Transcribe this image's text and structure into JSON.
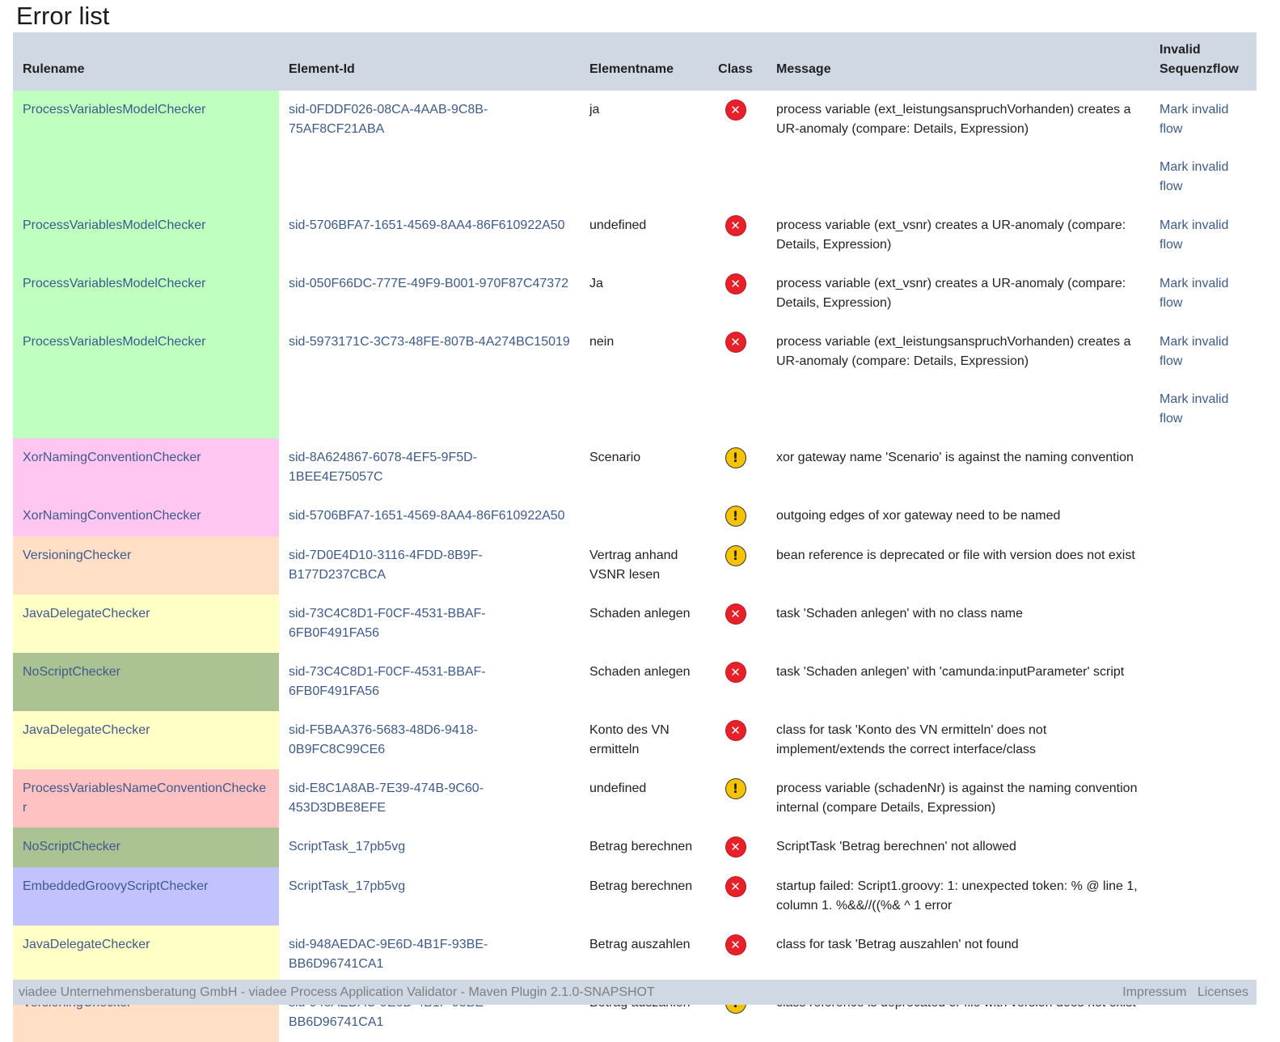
{
  "page": {
    "title": "Error list"
  },
  "table": {
    "headers": {
      "rulename": "Rulename",
      "element_id": "Element-Id",
      "elementname": "Elementname",
      "class": "Class",
      "message": "Message",
      "invalid_flow_line1": "Invalid",
      "invalid_flow_line2": "Sequenzflow"
    },
    "rows": [
      {
        "rule": "ProcessVariablesModelChecker",
        "color": "#bfffbf",
        "element_id": "sid-0FDDF026-08CA-4AAB-9C8B-75AF8CF21ABA",
        "elementname": "ja",
        "class": "error",
        "message": "process variable (ext_leistungsanspruchVorhanden) creates a UR-anomaly (compare: Details, Expression)",
        "flows": [
          "Mark invalid flow",
          "Mark invalid flow"
        ]
      },
      {
        "rule": "ProcessVariablesModelChecker",
        "color": "#bfffbf",
        "element_id": "sid-5706BFA7-1651-4569-8AA4-86F610922A50",
        "elementname": "undefined",
        "class": "error",
        "message": "process variable (ext_vsnr) creates a UR-anomaly (compare: Details, Expression)",
        "flows": [
          "Mark invalid flow"
        ]
      },
      {
        "rule": "ProcessVariablesModelChecker",
        "color": "#bfffbf",
        "element_id": "sid-050F66DC-777E-49F9-B001-970F87C47372",
        "elementname": "Ja",
        "class": "error",
        "message": "process variable (ext_vsnr) creates a UR-anomaly (compare: Details, Expression)",
        "flows": [
          "Mark invalid flow"
        ]
      },
      {
        "rule": "ProcessVariablesModelChecker",
        "color": "#bfffbf",
        "element_id": "sid-5973171C-3C73-48FE-807B-4A274BC15019",
        "elementname": "nein",
        "class": "error",
        "message": "process variable (ext_leistungsanspruchVorhanden) creates a UR-anomaly (compare: Details, Expression)",
        "flows": [
          "Mark invalid flow",
          "Mark invalid flow"
        ]
      },
      {
        "rule": "XorNamingConventionChecker",
        "color": "#ffc6f2",
        "element_id": "sid-8A624867-6078-4EF5-9F5D-1BEE4E75057C",
        "elementname": "Scenario",
        "class": "warning",
        "message": "xor gateway name 'Scenario' is against the naming convention",
        "flows": []
      },
      {
        "rule": "XorNamingConventionChecker",
        "color": "#ffc6f2",
        "element_id": "sid-5706BFA7-1651-4569-8AA4-86F610922A50",
        "elementname": "",
        "class": "warning",
        "message": "outgoing edges of xor gateway need to be named",
        "flows": []
      },
      {
        "rule": "VersioningChecker",
        "color": "#ffdfc6",
        "element_id": "sid-7D0E4D10-3116-4FDD-8B9F-B177D237CBCA",
        "elementname": "Vertrag anhand VSNR lesen",
        "class": "warning",
        "message": "bean reference is deprecated or file with version does not exist",
        "flows": []
      },
      {
        "rule": "JavaDelegateChecker",
        "color": "#ffffc6",
        "element_id": "sid-73C4C8D1-F0CF-4531-BBAF-6FB0F491FA56",
        "elementname": "Schaden anlegen",
        "class": "error",
        "message": "task 'Schaden anlegen' with no class name",
        "flows": []
      },
      {
        "rule": "NoScriptChecker",
        "color": "#abc393",
        "element_id": "sid-73C4C8D1-F0CF-4531-BBAF-6FB0F491FA56",
        "elementname": "Schaden anlegen",
        "class": "error",
        "message": "task 'Schaden anlegen' with 'camunda:inputParameter' script",
        "flows": []
      },
      {
        "rule": "JavaDelegateChecker",
        "color": "#ffffc6",
        "element_id": "sid-F5BAA376-5683-48D6-9418-0B9FC8C99CE6",
        "elementname": "Konto des VN ermitteln",
        "class": "error",
        "message": "class for task 'Konto des VN ermitteln' does not implement/extends the correct interface/class",
        "flows": []
      },
      {
        "rule": "ProcessVariablesNameConventionChecker",
        "color": "#ffc2c2",
        "element_id": "sid-E8C1A8AB-7E39-474B-9C60-453D3DBE8EFE",
        "elementname": "undefined",
        "class": "warning",
        "message": "process variable (schadenNr) is against the naming convention internal (compare Details, Expression)",
        "flows": []
      },
      {
        "rule": "NoScriptChecker",
        "color": "#abc393",
        "element_id": "ScriptTask_17pb5vg",
        "elementname": "Betrag berechnen",
        "class": "error",
        "message": "ScriptTask 'Betrag berechnen' not allowed",
        "flows": []
      },
      {
        "rule": "EmbeddedGroovyScriptChecker",
        "color": "#c2c2ff",
        "element_id": "ScriptTask_17pb5vg",
        "elementname": "Betrag berechnen",
        "class": "error",
        "message": "startup failed: Script1.groovy: 1: unexpected token: % @ line 1, column 1. %&&//((%& ^ 1 error",
        "flows": []
      },
      {
        "rule": "JavaDelegateChecker",
        "color": "#ffffc6",
        "element_id": "sid-948AEDAC-9E6D-4B1F-93BE-BB6D96741CA1",
        "elementname": "Betrag auszahlen",
        "class": "error",
        "message": "class for task 'Betrag auszahlen' not found",
        "flows": []
      },
      {
        "rule": "VersioningChecker",
        "color": "#ffdfc6",
        "element_id": "sid-948AEDAC-9E6D-4B1F-93BE-BB6D96741CA1",
        "elementname": "Betrag auszahlen",
        "class": "warning",
        "message": "class reference is deprecated or file with version does not exist",
        "flows": []
      }
    ]
  },
  "icons": {
    "error": "error-icon",
    "warning": "warning-icon"
  },
  "footer": {
    "text": "viadee Unternehmensberatung GmbH - viadee Process Application Validator - Maven Plugin 2.1.0-SNAPSHOT",
    "impressum": "Impressum",
    "licenses": "Licenses"
  }
}
